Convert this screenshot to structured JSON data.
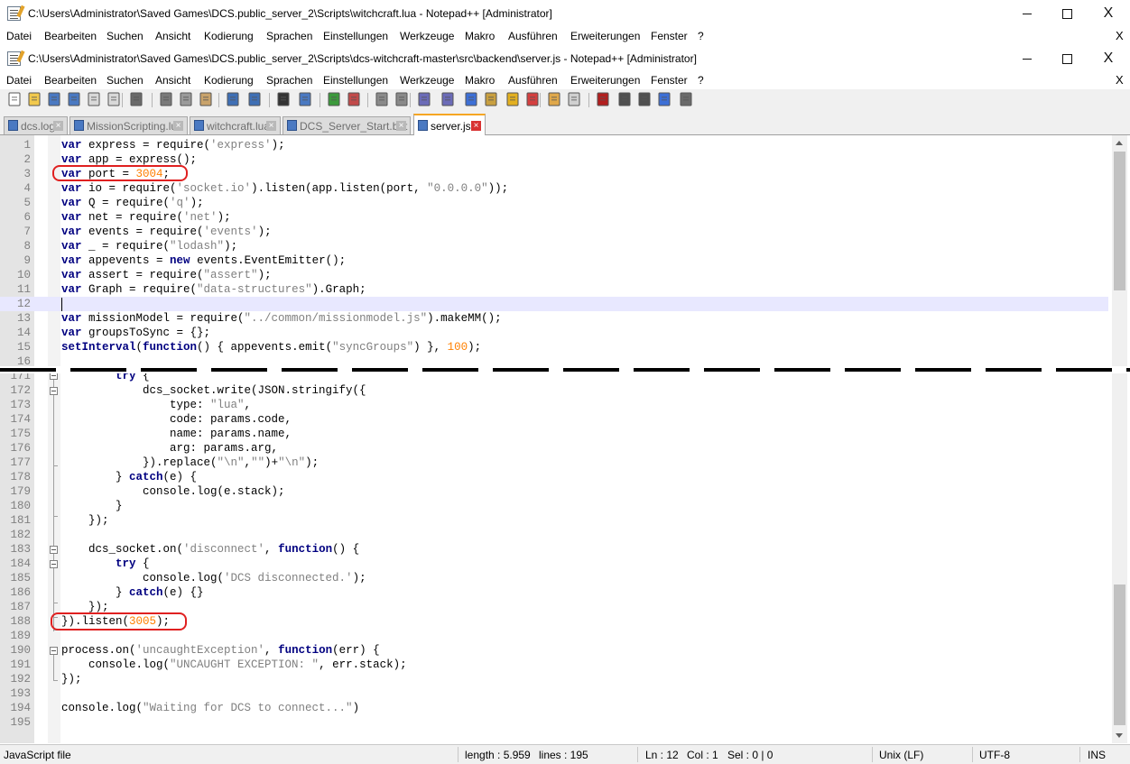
{
  "window1": {
    "title": "C:\\Users\\Administrator\\Saved Games\\DCS.public_server_2\\Scripts\\witchcraft.lua - Notepad++ [Administrator]",
    "close_glyph": "X"
  },
  "window2": {
    "title": "C:\\Users\\Administrator\\Saved Games\\DCS.public_server_2\\Scripts\\dcs-witchcraft-master\\src\\backend\\server.js - Notepad++ [Administrator]",
    "close_glyph": "X"
  },
  "menu": [
    "Datei",
    "Bearbeiten",
    "Suchen",
    "Ansicht",
    "Kodierung",
    "Sprachen",
    "Einstellungen",
    "Werkzeuge",
    "Makro",
    "Ausführen",
    "Erweiterungen",
    "Fenster",
    "?"
  ],
  "toolbar_icons": [
    "new-file-icon",
    "open-file-icon",
    "save-icon",
    "save-all-icon",
    "close-icon",
    "close-all-icon",
    "print-icon",
    "cut-icon",
    "copy-icon",
    "paste-icon",
    "undo-icon",
    "redo-icon",
    "find-icon",
    "replace-icon",
    "zoom-in-icon",
    "zoom-out-icon",
    "sync-vertical-icon",
    "sync-horizontal-icon",
    "word-wrap-icon",
    "show-all-chars-icon",
    "indent-guide-icon",
    "document-map-icon",
    "function-list-icon",
    "udl-icon",
    "folder-workspace-icon",
    "monitoring-icon",
    "record-macro-icon",
    "stop-macro-icon",
    "play-macro-icon",
    "run-macro-multiple-icon",
    "save-macro-icon"
  ],
  "tabs": [
    {
      "label": "dcs.log",
      "active": false
    },
    {
      "label": "MissionScripting.lua",
      "active": false
    },
    {
      "label": "witchcraft.lua",
      "active": false
    },
    {
      "label": "DCS_Server_Start.bat",
      "active": false
    },
    {
      "label": "server.js",
      "active": true
    }
  ],
  "code_top": [
    {
      "n": "1",
      "t": [
        [
          "kw",
          "var"
        ],
        [
          "p",
          " express = require("
        ],
        [
          "str",
          "'express'"
        ],
        [
          "p",
          ");"
        ]
      ]
    },
    {
      "n": "2",
      "t": [
        [
          "kw",
          "var"
        ],
        [
          "p",
          " app = express();"
        ]
      ]
    },
    {
      "n": "3",
      "t": [
        [
          "kw",
          "var"
        ],
        [
          "p",
          " port = "
        ],
        [
          "num",
          "3004"
        ],
        [
          "p",
          ";"
        ]
      ]
    },
    {
      "n": "4",
      "t": [
        [
          "kw",
          "var"
        ],
        [
          "p",
          " io = require("
        ],
        [
          "str",
          "'socket.io'"
        ],
        [
          "p",
          ").listen(app.listen(port, "
        ],
        [
          "str",
          "\"0.0.0.0\""
        ],
        [
          "p",
          "));"
        ]
      ]
    },
    {
      "n": "5",
      "t": [
        [
          "kw",
          "var"
        ],
        [
          "p",
          " Q = require("
        ],
        [
          "str",
          "'q'"
        ],
        [
          "p",
          ");"
        ]
      ]
    },
    {
      "n": "6",
      "t": [
        [
          "kw",
          "var"
        ],
        [
          "p",
          " net = require("
        ],
        [
          "str",
          "'net'"
        ],
        [
          "p",
          ");"
        ]
      ]
    },
    {
      "n": "7",
      "t": [
        [
          "kw",
          "var"
        ],
        [
          "p",
          " events = require("
        ],
        [
          "str",
          "'events'"
        ],
        [
          "p",
          ");"
        ]
      ]
    },
    {
      "n": "8",
      "t": [
        [
          "kw",
          "var"
        ],
        [
          "p",
          " _ = require("
        ],
        [
          "str",
          "\"lodash\""
        ],
        [
          "p",
          ");"
        ]
      ]
    },
    {
      "n": "9",
      "t": [
        [
          "kw",
          "var"
        ],
        [
          "p",
          " appevents = "
        ],
        [
          "kw",
          "new"
        ],
        [
          "p",
          " events.EventEmitter();"
        ]
      ]
    },
    {
      "n": "10",
      "t": [
        [
          "kw",
          "var"
        ],
        [
          "p",
          " assert = require("
        ],
        [
          "str",
          "\"assert\""
        ],
        [
          "p",
          ");"
        ]
      ]
    },
    {
      "n": "11",
      "t": [
        [
          "kw",
          "var"
        ],
        [
          "p",
          " Graph = require("
        ],
        [
          "str",
          "\"data-structures\""
        ],
        [
          "p",
          ").Graph;"
        ]
      ]
    },
    {
      "n": "12",
      "t": []
    },
    {
      "n": "13",
      "t": [
        [
          "kw",
          "var"
        ],
        [
          "p",
          " missionModel = require("
        ],
        [
          "str",
          "\"../common/missionmodel.js\""
        ],
        [
          "p",
          ").makeMM();"
        ]
      ]
    },
    {
      "n": "14",
      "t": [
        [
          "kw",
          "var"
        ],
        [
          "p",
          " groupsToSync = {};"
        ]
      ]
    },
    {
      "n": "15",
      "t": [
        [
          "kw",
          "setInterval"
        ],
        [
          "p",
          "("
        ],
        [
          "kw",
          "function"
        ],
        [
          "p",
          "() { appevents.emit("
        ],
        [
          "str",
          "\"syncGroups\""
        ],
        [
          "p",
          ") }, "
        ],
        [
          "num",
          "100"
        ],
        [
          "p",
          ");"
        ]
      ]
    },
    {
      "n": "16",
      "t": []
    }
  ],
  "code_bottom": [
    {
      "n": "171",
      "t": [
        [
          "p",
          "        "
        ],
        [
          "kw",
          "try"
        ],
        [
          "p",
          " {"
        ]
      ]
    },
    {
      "n": "172",
      "t": [
        [
          "p",
          "            dcs_socket.write(JSON.stringify({"
        ]
      ]
    },
    {
      "n": "173",
      "t": [
        [
          "p",
          "                type: "
        ],
        [
          "str",
          "\"lua\""
        ],
        [
          "p",
          ","
        ]
      ]
    },
    {
      "n": "174",
      "t": [
        [
          "p",
          "                code: params.code,"
        ]
      ]
    },
    {
      "n": "175",
      "t": [
        [
          "p",
          "                name: params.name,"
        ]
      ]
    },
    {
      "n": "176",
      "t": [
        [
          "p",
          "                arg: params.arg,"
        ]
      ]
    },
    {
      "n": "177",
      "t": [
        [
          "p",
          "            }).replace("
        ],
        [
          "str",
          "\"\\n\""
        ],
        [
          "p",
          ","
        ],
        [
          "str",
          "\"\""
        ],
        [
          "p",
          ")+"
        ],
        [
          "str",
          "\"\\n\""
        ],
        [
          "p",
          ");"
        ]
      ]
    },
    {
      "n": "178",
      "t": [
        [
          "p",
          "        } "
        ],
        [
          "kw",
          "catch"
        ],
        [
          "p",
          "(e) {"
        ]
      ]
    },
    {
      "n": "179",
      "t": [
        [
          "p",
          "            console.log(e.stack);"
        ]
      ]
    },
    {
      "n": "180",
      "t": [
        [
          "p",
          "        }"
        ]
      ]
    },
    {
      "n": "181",
      "t": [
        [
          "p",
          "    });"
        ]
      ]
    },
    {
      "n": "182",
      "t": []
    },
    {
      "n": "183",
      "t": [
        [
          "p",
          "    dcs_socket.on("
        ],
        [
          "str",
          "'disconnect'"
        ],
        [
          "p",
          ", "
        ],
        [
          "kw",
          "function"
        ],
        [
          "p",
          "() {"
        ]
      ]
    },
    {
      "n": "184",
      "t": [
        [
          "p",
          "        "
        ],
        [
          "kw",
          "try"
        ],
        [
          "p",
          " {"
        ]
      ]
    },
    {
      "n": "185",
      "t": [
        [
          "p",
          "            console.log("
        ],
        [
          "str",
          "'DCS disconnected.'"
        ],
        [
          "p",
          ");"
        ]
      ]
    },
    {
      "n": "186",
      "t": [
        [
          "p",
          "        } "
        ],
        [
          "kw",
          "catch"
        ],
        [
          "p",
          "(e) {}"
        ]
      ]
    },
    {
      "n": "187",
      "t": [
        [
          "p",
          "    });"
        ]
      ]
    },
    {
      "n": "188",
      "t": [
        [
          "p",
          "}).listen("
        ],
        [
          "num",
          "3005"
        ],
        [
          "p",
          ");"
        ]
      ]
    },
    {
      "n": "189",
      "t": []
    },
    {
      "n": "190",
      "t": [
        [
          "p",
          "process.on("
        ],
        [
          "str",
          "'uncaughtException'"
        ],
        [
          "p",
          ", "
        ],
        [
          "kw",
          "function"
        ],
        [
          "p",
          "(err) {"
        ]
      ]
    },
    {
      "n": "191",
      "t": [
        [
          "p",
          "    console.log("
        ],
        [
          "str",
          "\"UNCAUGHT EXCEPTION: \""
        ],
        [
          "p",
          ", err.stack);"
        ]
      ]
    },
    {
      "n": "192",
      "t": [
        [
          "p",
          "});"
        ]
      ]
    },
    {
      "n": "193",
      "t": []
    },
    {
      "n": "194",
      "t": [
        [
          "p",
          "console.log("
        ],
        [
          "str",
          "\"Waiting for DCS to connect...\""
        ],
        [
          "p",
          ")"
        ]
      ]
    },
    {
      "n": "195",
      "t": []
    }
  ],
  "current_line": "12",
  "status": {
    "file_type": "JavaScript file",
    "length": "length : 5.959",
    "lines": "lines : 195",
    "ln": "Ln : 12",
    "col": "Col : 1",
    "sel": "Sel : 0 | 0",
    "eol": "Unix (LF)",
    "encoding": "UTF-8",
    "mode": "INS"
  },
  "colors": {
    "keyword": "#000080",
    "string": "#808080",
    "number": "#ff8000",
    "current_line": "#e8e8ff",
    "annotation_red": "#e02020",
    "active_tab_accent": "#f5a623"
  }
}
